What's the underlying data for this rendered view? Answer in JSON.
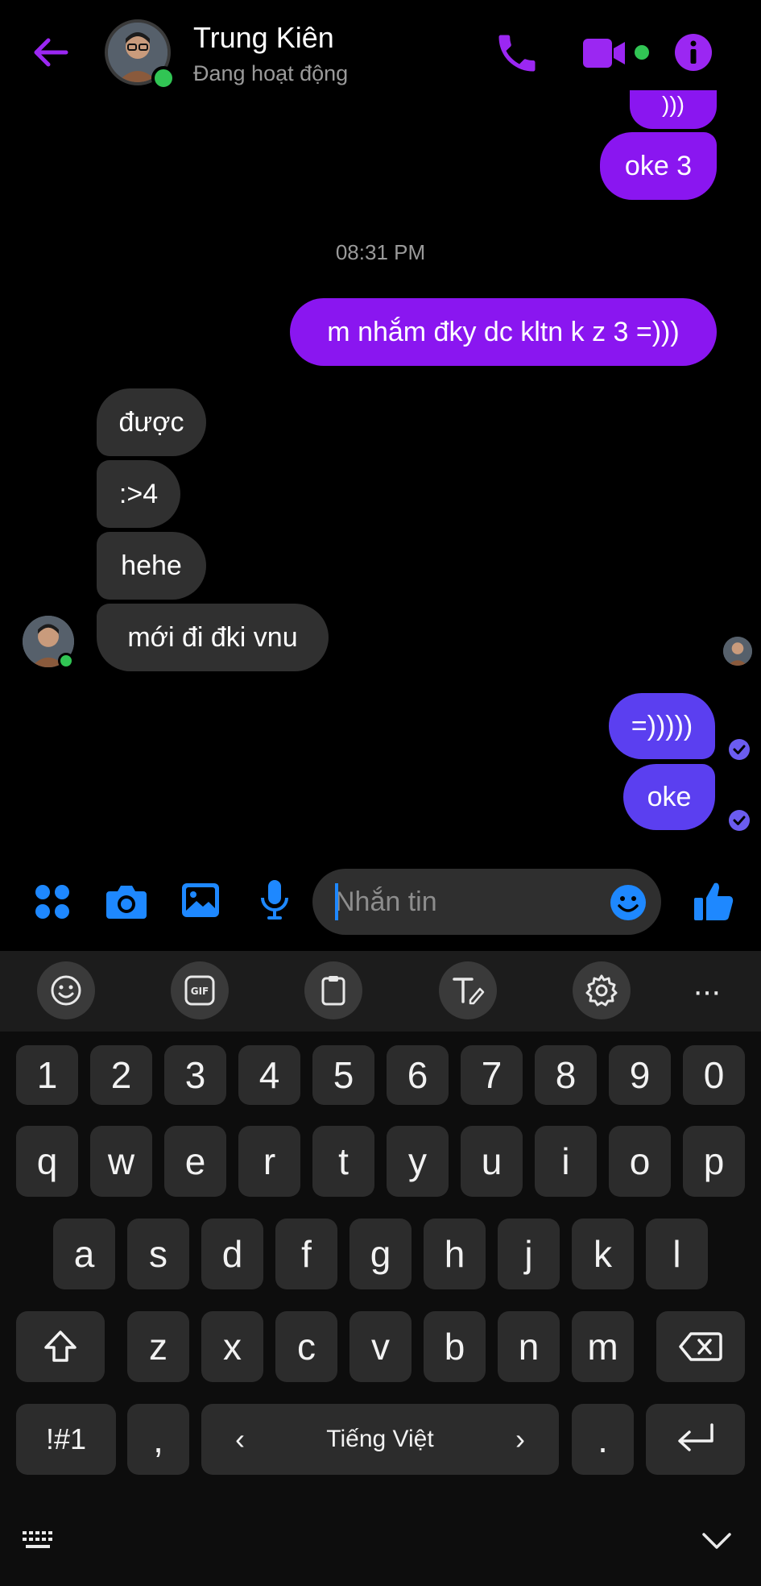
{
  "header": {
    "contact_name": "Trung Kiên",
    "status": "Đang hoạt động",
    "accent": "#9b27f2"
  },
  "messages": {
    "partial_top": ")))",
    "oke3": "oke 3",
    "timestamp": "08:31 PM",
    "sent_long": "m nhắm đky dc kltn k z 3 =)))",
    "recv1": "được",
    "recv2": ":>4",
    "recv3": "hehe",
    "recv4": "mới đi đki vnu",
    "sent_blue1": "=)))))",
    "sent_blue2": "oke"
  },
  "composer": {
    "placeholder": "Nhắn tin"
  },
  "keyboard": {
    "numbers": [
      "1",
      "2",
      "3",
      "4",
      "5",
      "6",
      "7",
      "8",
      "9",
      "0"
    ],
    "row1": [
      "q",
      "w",
      "e",
      "r",
      "t",
      "y",
      "u",
      "i",
      "o",
      "p"
    ],
    "row2": [
      "a",
      "s",
      "d",
      "f",
      "g",
      "h",
      "j",
      "k",
      "l"
    ],
    "row3": [
      "z",
      "x",
      "c",
      "v",
      "b",
      "n",
      "m"
    ],
    "symbols": "!#1",
    "comma": ",",
    "period": ".",
    "language": "Tiếng Việt",
    "lang_prev": "‹",
    "lang_next": "›",
    "toolbar_more": "···"
  }
}
